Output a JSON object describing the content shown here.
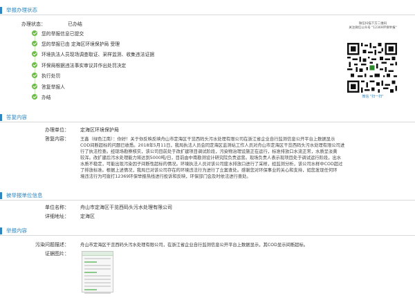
{
  "progress": {
    "section_title": "举报办理状态",
    "status_label": "办理状态：",
    "status_value": "已办结",
    "steps": [
      "您的举报信息已提交",
      "您的举报已由 定海区环境保护局 受理",
      "环境执法人员现场调查取证、采样监测、收集违法证据",
      "环保局根据违法事实审议并作出处罚决定",
      "执行处罚",
      "答复举报人",
      "办结"
    ],
    "step_color": "#6cbd45"
  },
  "qr": {
    "caption_line1": "微信扫描下方二维码",
    "caption_line2": "关注微信公众号 \"12369环保举报\"",
    "footer": "微信 \"扫一扫\""
  },
  "reply": {
    "section_title": "答复内容",
    "unit_label": "办理单位：",
    "unit_value": "定海区环境保护局",
    "content_label": "答复内容：",
    "content_lines": [
      "王鑫（绿色江南）：你好！关于你反映反映舟山市定海区干览西码头污水处理有限公司在浙江省企业自行监测信息公开平台上数据显示",
      "COD间断超标的问题已收悉。2018年5月11日，我局执法人员会同定海区监测站工作人员对舟山市定海区干览西码头污水处理有限公司进",
      "行了执法检查。经现场勘察核实，该公司目前处于改扩建项目调试阶段，污染物治理设施正在运行，标准排放口水流正常，水质呈淡黄",
      "较浑。改扩建后污水处理能力将达到5000吨/日，目前由中南勘测设计研究院负责运营。现场负责人表示现项目处于调试运行阶段，出水",
      "水质不稳定，可能出现污染因子间断性超标的情况。环境执法人员对该公司废水排放口进行了采样，经监测分析，该公司水样中COD超过",
      "了排放标准。根据上述情况，我局已对该公司存在的环境违法行为进行了立案查处。感谢您对环保事业的关心和支持，如您发现任何环",
      "境违法行为可拨打12369环保举报热线进行投诉和反映，环保部门会及时依法进行查处。"
    ]
  },
  "reported": {
    "section_title": "被举报单位信息",
    "name_label": "单位名称：",
    "name_value": "舟山市定海区干览西码头污水处理有限公司",
    "address_label": "详细地址：",
    "address_value": "定海区"
  },
  "report": {
    "section_title": "举报内容",
    "desc_label": "污染问题描述：",
    "desc_value": "舟山市定海区干览西码头污水处理有限公司，在浙江省企业自行监测信息公开平台上数据显示，其COD显示间断超标。",
    "images_label": "证据图片："
  },
  "accent_color": "#2e86c1"
}
